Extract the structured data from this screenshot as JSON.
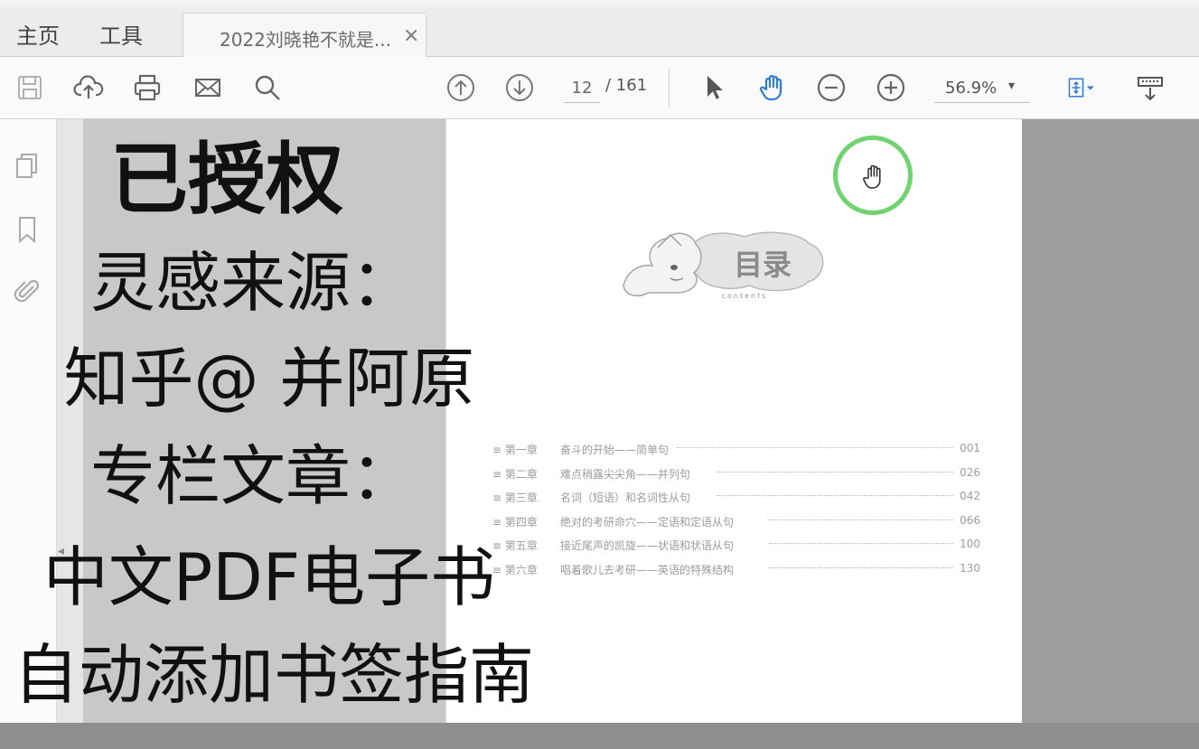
{
  "tabs": {
    "home": "主页",
    "tools": "工具",
    "document": "2022刘晓艳不就是...",
    "close": "×"
  },
  "toolbar": {
    "icons": [
      "save-icon",
      "upload-icon",
      "print-icon",
      "email-icon",
      "search-icon",
      "prev-page-icon",
      "next-page-icon",
      "select-cursor-icon",
      "hand-tool-icon",
      "zoom-out-icon",
      "zoom-in-icon",
      "fit-page-icon",
      "reading-mode-icon"
    ],
    "page_current": "12",
    "page_total": "/ 161",
    "zoom": "56.9%",
    "zoom_caret": "▾"
  },
  "left_panel": {
    "icons": [
      "pages-icon",
      "bookmark-icon",
      "attachment-icon"
    ],
    "collapse": "◂"
  },
  "overlay": {
    "line1": "已授权",
    "line2": "灵感来源：",
    "line3": "知乎@ 并阿原",
    "line4": "专栏文章：",
    "line5": "中文PDF电子书",
    "line6": "自动添加书签指南"
  },
  "page": {
    "badge": "目录",
    "badge_sub": "contents",
    "toc": [
      {
        "chapter": "≡ 第一章",
        "title": "奋斗的开始——简单句",
        "page": "001"
      },
      {
        "chapter": "≡ 第二章",
        "title": "难点稍露尖尖角——并列句",
        "page": "026"
      },
      {
        "chapter": "≡ 第三章",
        "title": "名词（短语）和名词性从句",
        "page": "042"
      },
      {
        "chapter": "≡ 第四章",
        "title": "绝对的考研命穴——定语和定语从句",
        "page": "066"
      },
      {
        "chapter": "≡ 第五章",
        "title": "接近尾声的凯旋——状语和状语从句",
        "page": "100"
      },
      {
        "chapter": "≡ 第六章",
        "title": "唱着歌儿去考研——英语的特殊结构",
        "page": "130"
      }
    ]
  },
  "colors": {
    "accent_blue": "#2f7bd6",
    "cursor_ring": "#6fd36f"
  }
}
